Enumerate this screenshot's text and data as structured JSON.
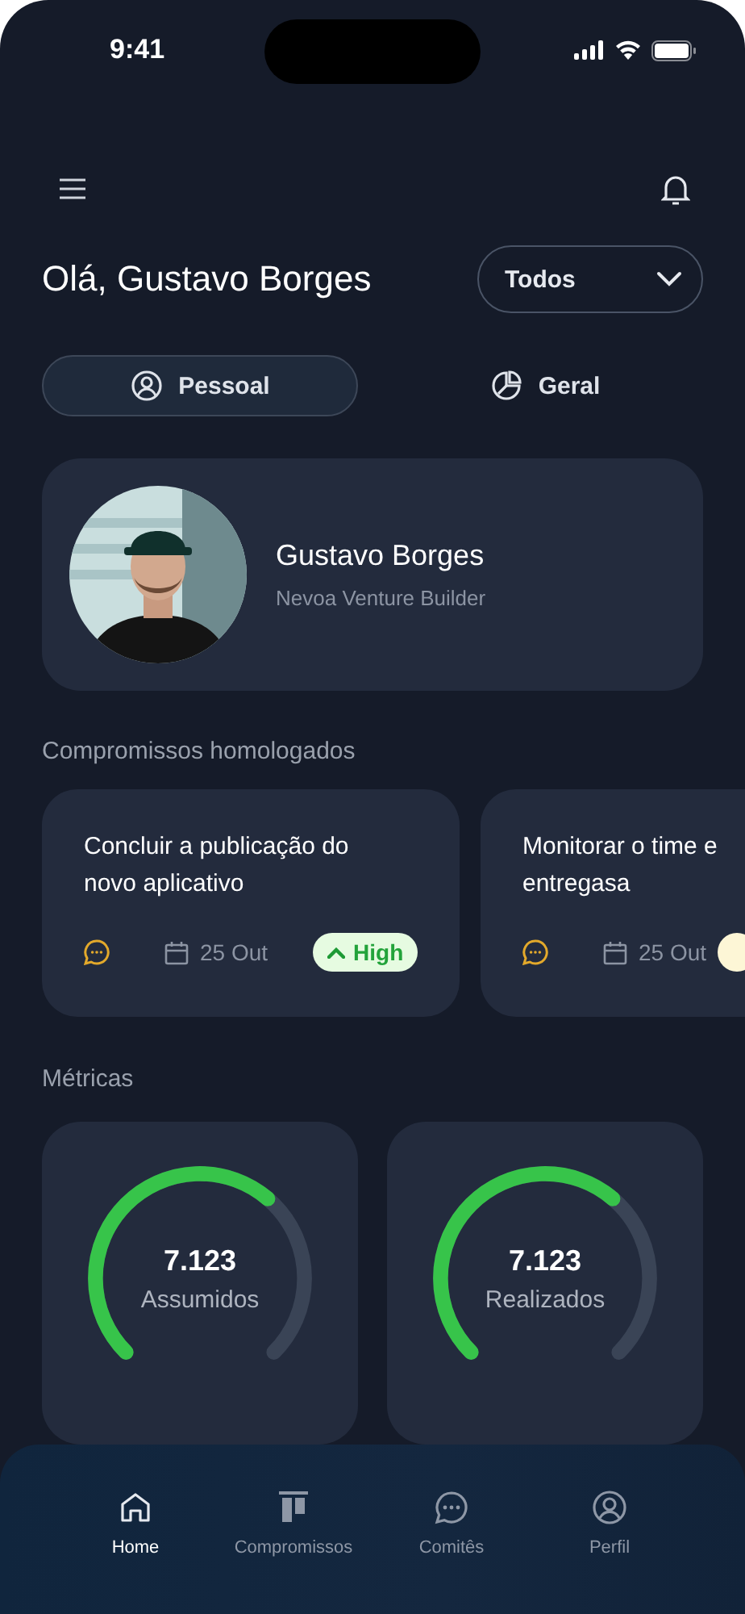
{
  "status_bar": {
    "time": "9:41"
  },
  "header": {
    "greeting": "Olá, Gustavo Borges",
    "filter": {
      "value": "Todos"
    }
  },
  "tabs": [
    {
      "label": "Pessoal",
      "kind": "person",
      "selected": true
    },
    {
      "label": "Geral",
      "kind": "pie",
      "selected": false
    }
  ],
  "profile": {
    "name": "Gustavo Borges",
    "company": "Nevoa Venture Builder"
  },
  "commitments": {
    "title": "Compromissos homologados",
    "items": [
      {
        "title": "Concluir a publicação do\nnovo aplicativo",
        "date": "25 Out",
        "priority": {
          "label": "High",
          "color": "#e6fbe1"
        }
      },
      {
        "title": "Monitorar o time e\nentregasa",
        "date": "25 Out",
        "priority": {
          "color": "#fdf6d6"
        }
      }
    ]
  },
  "metrics": {
    "title": "Métricas",
    "items": [
      {
        "value": "7.123",
        "label": "Assumidos"
      },
      {
        "value": "7.123",
        "label": "Realizados"
      }
    ]
  },
  "nav": [
    {
      "label": "Home",
      "kind": "home",
      "selected": true
    },
    {
      "label": "Compromissos",
      "kind": "board",
      "selected": false
    },
    {
      "label": "Comitês",
      "kind": "chat",
      "selected": false
    },
    {
      "label": "Perfil",
      "kind": "user",
      "selected": false
    }
  ]
}
